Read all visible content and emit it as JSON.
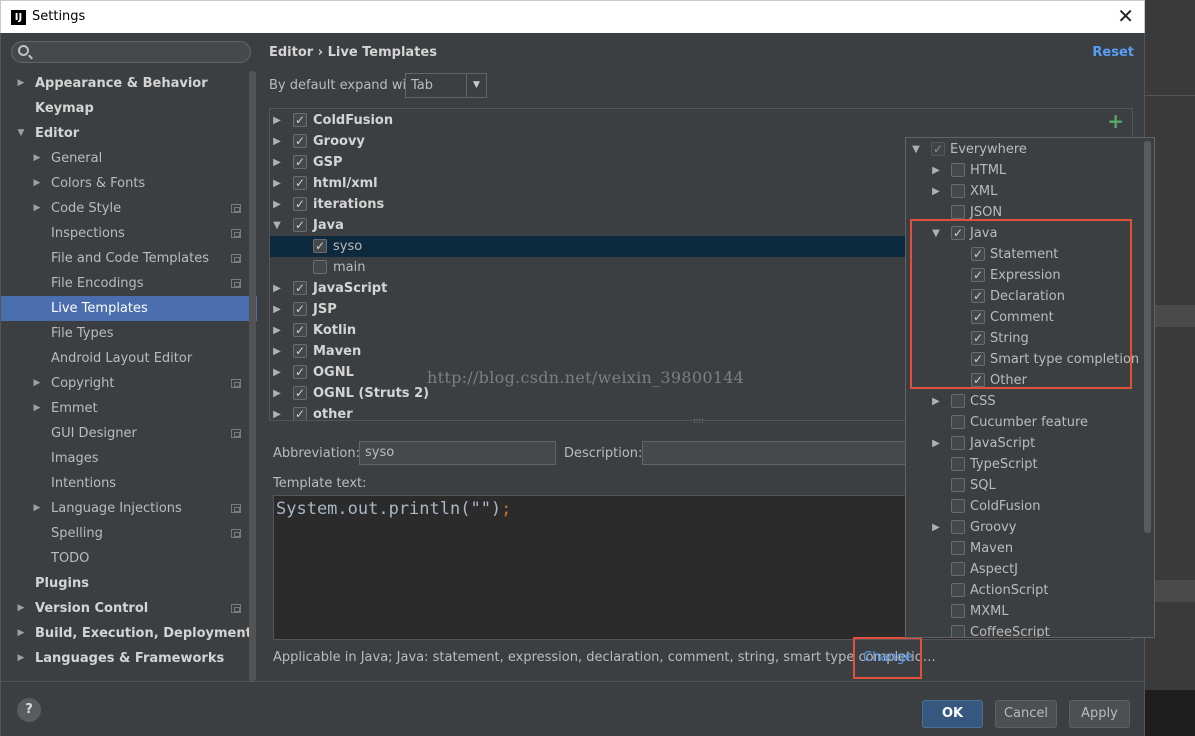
{
  "window": {
    "title": "Settings",
    "app_icon_text": "IJ"
  },
  "sidebar": {
    "items": [
      {
        "label": "Appearance & Behavior",
        "level": 0,
        "arrow": "right",
        "bold": true
      },
      {
        "label": "Keymap",
        "level": 0,
        "arrow": "",
        "bold": true
      },
      {
        "label": "Editor",
        "level": 0,
        "arrow": "down",
        "bold": true
      },
      {
        "label": "General",
        "level": 1,
        "arrow": "right"
      },
      {
        "label": "Colors & Fonts",
        "level": 1,
        "arrow": "right"
      },
      {
        "label": "Code Style",
        "level": 1,
        "arrow": "right",
        "project": true
      },
      {
        "label": "Inspections",
        "level": 1,
        "arrow": "",
        "project": true
      },
      {
        "label": "File and Code Templates",
        "level": 1,
        "arrow": "",
        "project": true
      },
      {
        "label": "File Encodings",
        "level": 1,
        "arrow": "",
        "project": true
      },
      {
        "label": "Live Templates",
        "level": 1,
        "arrow": "",
        "selected": true
      },
      {
        "label": "File Types",
        "level": 1,
        "arrow": ""
      },
      {
        "label": "Android Layout Editor",
        "level": 1,
        "arrow": ""
      },
      {
        "label": "Copyright",
        "level": 1,
        "arrow": "right",
        "project": true
      },
      {
        "label": "Emmet",
        "level": 1,
        "arrow": "right"
      },
      {
        "label": "GUI Designer",
        "level": 1,
        "arrow": "",
        "project": true
      },
      {
        "label": "Images",
        "level": 1,
        "arrow": ""
      },
      {
        "label": "Intentions",
        "level": 1,
        "arrow": ""
      },
      {
        "label": "Language Injections",
        "level": 1,
        "arrow": "right",
        "project": true
      },
      {
        "label": "Spelling",
        "level": 1,
        "arrow": "",
        "project": true
      },
      {
        "label": "TODO",
        "level": 1,
        "arrow": ""
      },
      {
        "label": "Plugins",
        "level": 0,
        "arrow": "",
        "bold": true
      },
      {
        "label": "Version Control",
        "level": 0,
        "arrow": "right",
        "bold": true,
        "project": true
      },
      {
        "label": "Build, Execution, Deployment",
        "level": 0,
        "arrow": "right",
        "bold": true
      },
      {
        "label": "Languages & Frameworks",
        "level": 0,
        "arrow": "right",
        "bold": true
      }
    ]
  },
  "header": {
    "breadcrumb": "Editor › Live Templates",
    "reset_label": "Reset",
    "expand_label": "By default expand with",
    "expand_value": "Tab"
  },
  "templates": [
    {
      "label": "ColdFusion",
      "level": 0,
      "arrow": "right",
      "checked": true
    },
    {
      "label": "Groovy",
      "level": 0,
      "arrow": "right",
      "checked": true
    },
    {
      "label": "GSP",
      "level": 0,
      "arrow": "right",
      "checked": true
    },
    {
      "label": "html/xml",
      "level": 0,
      "arrow": "right",
      "checked": true
    },
    {
      "label": "iterations",
      "level": 0,
      "arrow": "right",
      "checked": true
    },
    {
      "label": "Java",
      "level": 0,
      "arrow": "down",
      "checked": true
    },
    {
      "label": "syso",
      "level": 1,
      "arrow": "",
      "checked": true,
      "selected": true
    },
    {
      "label": "main",
      "level": 1,
      "arrow": "",
      "checked": false
    },
    {
      "label": "JavaScript",
      "level": 0,
      "arrow": "right",
      "checked": true
    },
    {
      "label": "JSP",
      "level": 0,
      "arrow": "right",
      "checked": true
    },
    {
      "label": "Kotlin",
      "level": 0,
      "arrow": "right",
      "checked": true
    },
    {
      "label": "Maven",
      "level": 0,
      "arrow": "right",
      "checked": true
    },
    {
      "label": "OGNL",
      "level": 0,
      "arrow": "right",
      "checked": true
    },
    {
      "label": "OGNL (Struts 2)",
      "level": 0,
      "arrow": "right",
      "checked": true
    },
    {
      "label": "other",
      "level": 0,
      "arrow": "right",
      "checked": true
    }
  ],
  "form": {
    "abbreviation_label": "Abbreviation:",
    "abbreviation_value": "syso",
    "description_label": "Description:",
    "template_text_label": "Template text:",
    "template_code": "System.out.println(\"\")",
    "template_semicolon": ";",
    "applicable_text": "Applicable in Java; Java: statement, expression, declaration, comment, string, smart type completio…",
    "change_label": "Change"
  },
  "contexts": [
    {
      "label": "Everywhere",
      "level": 0,
      "arrow": "down",
      "checked": true,
      "partial": true
    },
    {
      "label": "HTML",
      "level": 1,
      "arrow": "right",
      "checked": false
    },
    {
      "label": "XML",
      "level": 1,
      "arrow": "right",
      "checked": false
    },
    {
      "label": "JSON",
      "level": 1,
      "arrow": "",
      "checked": false
    },
    {
      "label": "Java",
      "level": 1,
      "arrow": "down",
      "checked": true
    },
    {
      "label": "Statement",
      "level": 2,
      "arrow": "",
      "checked": true
    },
    {
      "label": "Expression",
      "level": 2,
      "arrow": "",
      "checked": true
    },
    {
      "label": "Declaration",
      "level": 2,
      "arrow": "",
      "checked": true
    },
    {
      "label": "Comment",
      "level": 2,
      "arrow": "",
      "checked": true
    },
    {
      "label": "String",
      "level": 2,
      "arrow": "",
      "checked": true
    },
    {
      "label": "Smart type completion",
      "level": 2,
      "arrow": "",
      "checked": true
    },
    {
      "label": "Other",
      "level": 2,
      "arrow": "",
      "checked": true
    },
    {
      "label": "CSS",
      "level": 1,
      "arrow": "right",
      "checked": false
    },
    {
      "label": "Cucumber feature",
      "level": 1,
      "arrow": "",
      "checked": false
    },
    {
      "label": "JavaScript",
      "level": 1,
      "arrow": "right",
      "checked": false
    },
    {
      "label": "TypeScript",
      "level": 1,
      "arrow": "",
      "checked": false
    },
    {
      "label": "SQL",
      "level": 1,
      "arrow": "",
      "checked": false
    },
    {
      "label": "ColdFusion",
      "level": 1,
      "arrow": "",
      "checked": false
    },
    {
      "label": "Groovy",
      "level": 1,
      "arrow": "right",
      "checked": false
    },
    {
      "label": "Maven",
      "level": 1,
      "arrow": "",
      "checked": false
    },
    {
      "label": "AspectJ",
      "level": 1,
      "arrow": "",
      "checked": false
    },
    {
      "label": "ActionScript",
      "level": 1,
      "arrow": "",
      "checked": false
    },
    {
      "label": "MXML",
      "level": 1,
      "arrow": "",
      "checked": false
    },
    {
      "label": "CoffeeScript",
      "level": 1,
      "arrow": "",
      "checked": false
    }
  ],
  "footer": {
    "help_label": "?",
    "ok_label": "OK",
    "cancel_label": "Cancel",
    "apply_label": "Apply"
  },
  "watermark": "http://blog.csdn.net/weixin_39800144",
  "colors": {
    "accent": "#4b6eaf",
    "link": "#589df6",
    "highlight_box": "#e0503a",
    "add": "#59a869"
  }
}
